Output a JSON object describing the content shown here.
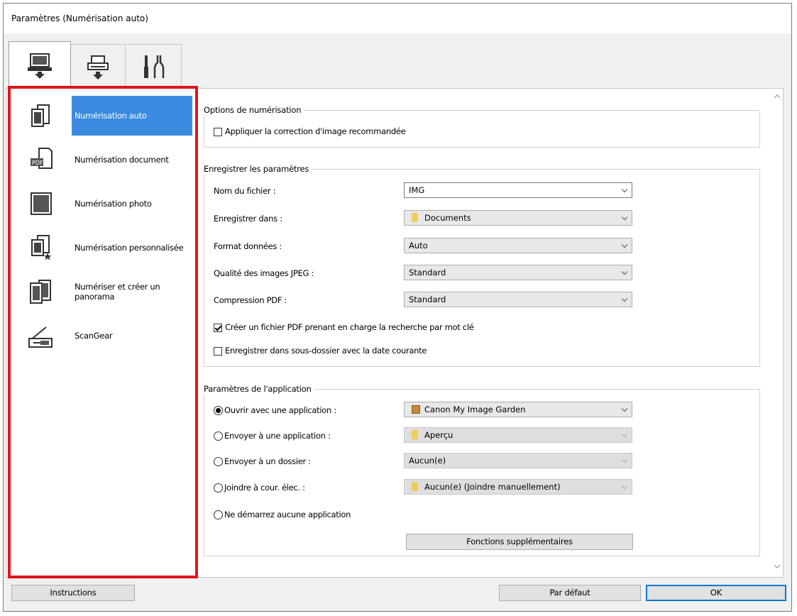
{
  "window": {
    "title": "Paramètres (Numérisation auto)"
  },
  "tabs": [
    {
      "icon": "computer-scan-icon",
      "active": true
    },
    {
      "icon": "scanner-panel-icon",
      "active": false
    },
    {
      "icon": "general-settings-tools-icon",
      "active": false
    }
  ],
  "sidebar": {
    "items": [
      {
        "label": "Numérisation auto",
        "icon": "auto-scan-icon",
        "selected": true
      },
      {
        "label": "Numérisation document",
        "icon": "pdf-document-scan-icon",
        "selected": false
      },
      {
        "label": "Numérisation photo",
        "icon": "photo-scan-icon",
        "selected": false
      },
      {
        "label": "Numérisation personnalisée",
        "icon": "custom-scan-icon",
        "selected": false
      },
      {
        "label": "Numériser et créer un panorama",
        "icon": "panorama-icon",
        "selected": false
      },
      {
        "label": "ScanGear",
        "icon": "scangear-icon",
        "selected": false
      }
    ]
  },
  "scan_options": {
    "title": "Options de numérisation",
    "apply_correction": {
      "label": "Appliquer la correction d'image recommandée",
      "checked": false
    }
  },
  "save_settings": {
    "title": "Enregistrer les paramètres",
    "file_name": {
      "label": "Nom du fichier :",
      "value": "IMG"
    },
    "save_in": {
      "label": "Enregistrer dans :",
      "value": "Documents"
    },
    "data_format": {
      "label": "Format données :",
      "value": "Auto"
    },
    "jpeg_quality": {
      "label": "Qualité des images JPEG :",
      "value": "Standard"
    },
    "pdf_compression": {
      "label": "Compression PDF :",
      "value": "Standard"
    },
    "keyword_pdf": {
      "label": "Créer un fichier PDF prenant en charge la recherche par mot clé",
      "checked": true
    },
    "subfolder_date": {
      "label": "Enregistrer dans sous-dossier avec la date courante",
      "checked": false
    }
  },
  "app_settings": {
    "title": "Paramètres de l'application",
    "open_with": {
      "label": "Ouvrir avec une application :",
      "value": "Canon My Image Garden",
      "checked": true
    },
    "send_to_app": {
      "label": "Envoyer à une application :",
      "value": "Aperçu",
      "checked": false
    },
    "send_to_folder": {
      "label": "Envoyer à un dossier :",
      "value": "Aucun(e)",
      "checked": false
    },
    "attach_email": {
      "label": "Joindre à cour. élec. :",
      "value": "Aucun(e) (Joindre manuellement)",
      "checked": false
    },
    "no_app": {
      "label": "Ne démarrez aucune application",
      "checked": false
    },
    "more_functions": "Fonctions supplémentaires"
  },
  "footer": {
    "instructions": "Instructions",
    "defaults": "Par défaut",
    "ok": "OK"
  }
}
